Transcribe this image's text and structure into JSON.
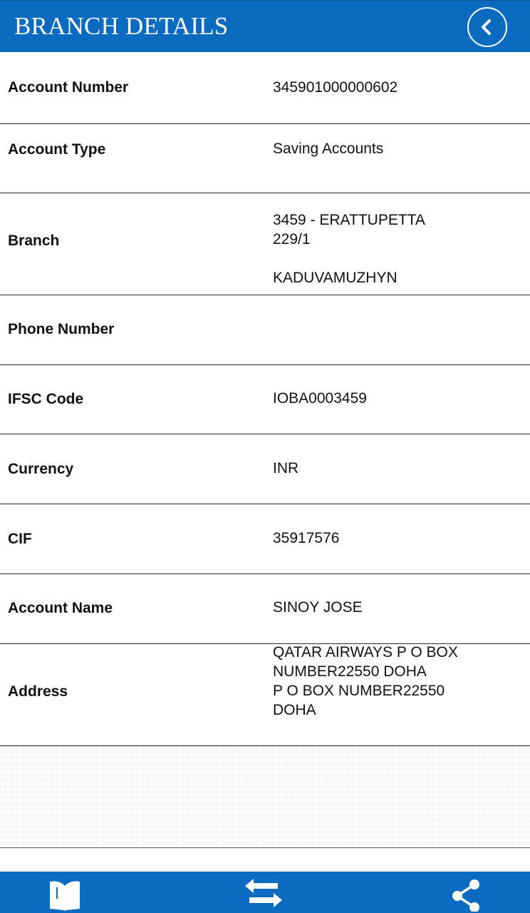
{
  "header": {
    "title": "BRANCH DETAILS",
    "back_icon": "chevron-left-icon"
  },
  "details": {
    "account_number": {
      "label": "Account Number",
      "value": "345901000000602"
    },
    "account_type": {
      "label": "Account Type",
      "value": "Saving Accounts"
    },
    "branch": {
      "label": "Branch",
      "value": "3459 - ERATTUPETTA\n229/1\n\nKADUVAMUZHYN"
    },
    "phone_number": {
      "label": "Phone Number",
      "value": ""
    },
    "ifsc_code": {
      "label": "IFSC Code",
      "value": "IOBA0003459"
    },
    "currency": {
      "label": "Currency",
      "value": "INR"
    },
    "cif": {
      "label": "CIF",
      "value": "35917576"
    },
    "account_name": {
      "label": "Account Name",
      "value": "SINOY JOSE"
    },
    "address": {
      "label": "Address",
      "value": "QATAR AIRWAYS P O BOX\nNUMBER22550 DOHA\nP O BOX NUMBER22550\nDOHA"
    }
  },
  "footer": {
    "icons": [
      "book-icon",
      "transfer-icon",
      "share-icon"
    ]
  },
  "colors": {
    "brand_blue": "#0a6bc0",
    "text": "#111111",
    "divider": "#2a2a2a"
  }
}
